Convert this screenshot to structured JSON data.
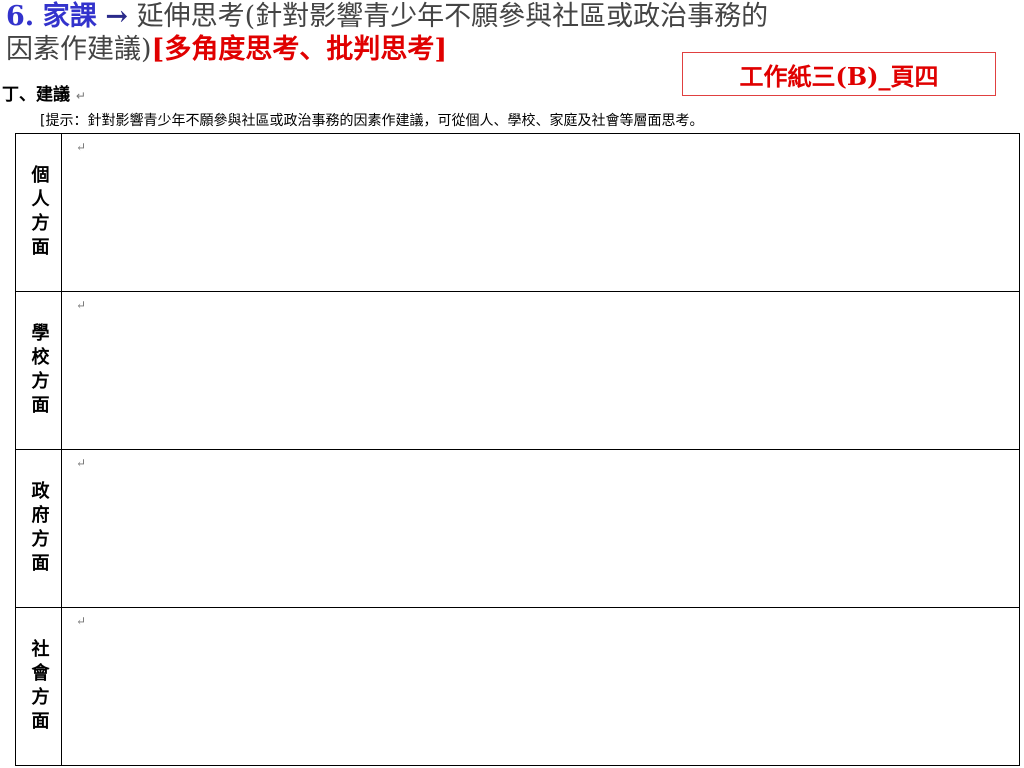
{
  "header": {
    "number": "6.",
    "homework": "家課",
    "arrow": "→",
    "topic": "延伸思考(針對影響青少年不願參與社區或政治事務的",
    "topic_cont": "因素作建議)",
    "skills": "[多角度思考、批判思考]"
  },
  "badge": "工作紙三(B)_頁四",
  "section": {
    "title": "丁、建議",
    "hint": "[提示：針對影響青少年不願參與社區或政治事務的因素作建議，可從個人、學校、家庭及社會等層面思考。"
  },
  "paragraph_mark": "↵",
  "rows": [
    {
      "label": "個人方面"
    },
    {
      "label": "學校方面"
    },
    {
      "label": "政府方面"
    },
    {
      "label": "社會方面"
    }
  ],
  "colors": {
    "blue": "#3333cc",
    "red": "#e00000"
  }
}
